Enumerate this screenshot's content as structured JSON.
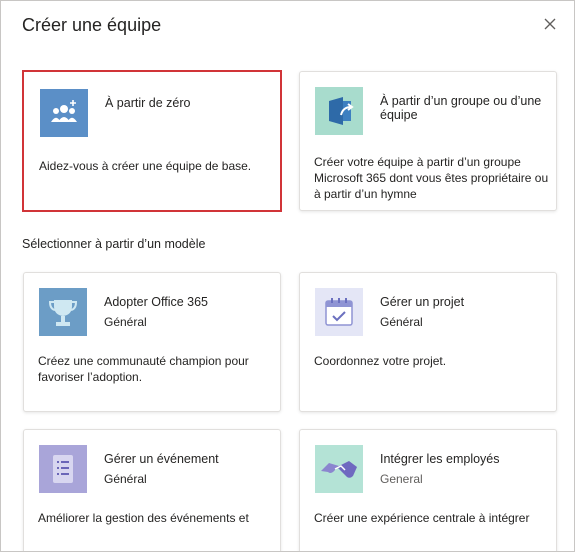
{
  "dialog": {
    "title": "Créer une équipe",
    "close_label": "Fermer"
  },
  "start_options": [
    {
      "name": "À partir de zéro",
      "description": "Aidez-vous à créer une équipe de base.",
      "icon": "team-people-icon",
      "selected": true
    },
    {
      "name": "À partir d’un groupe ou d’une équipe",
      "description": "Créer votre équipe à partir d’un groupe Microsoft 365 dont vous êtes propriétaire ou à partir d’un hymne",
      "icon": "group-arrow-icon"
    }
  ],
  "templates_section_label": "Sélectionner à partir d’un modèle",
  "templates": [
    {
      "name": "Adopter Office 365",
      "category": "Général",
      "description": "Créez une communauté champion pour favoriser l’adoption.",
      "icon": "trophy-icon"
    },
    {
      "name": "Gérer un projet",
      "category": "Général",
      "description": "Coordonnez votre projet.",
      "icon": "calendar-check-icon"
    },
    {
      "name": "Gérer un événement",
      "category": "Général",
      "description": "Améliorer la gestion des événements et",
      "icon": "checklist-icon"
    },
    {
      "name": "Intégrer les employés",
      "category": "General",
      "description": "Créer une expérience centrale à intégrer",
      "icon": "handshake-icon"
    }
  ],
  "colors": {
    "selected_border": "#d13438",
    "scratch_icon_bg": "#5b8fc7",
    "group_icon_bg": "#a8dccd",
    "trophy_icon_bg": "#6c9dc6",
    "project_icon_bg": "#e4e6f6",
    "event_icon_bg": "#a9a5d9",
    "onboard_icon_bg": "#b4e3d6"
  }
}
